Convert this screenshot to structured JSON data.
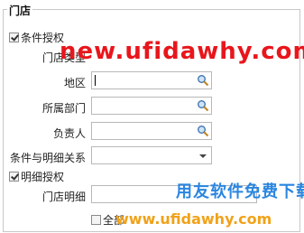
{
  "group_title": "门店",
  "condition_auth": {
    "label": "条件授权",
    "checked": true
  },
  "fields": [
    {
      "label": "门店类型",
      "value": ""
    },
    {
      "label": "地区",
      "value": ""
    },
    {
      "label": "所属部门",
      "value": ""
    },
    {
      "label": "负责人",
      "value": ""
    }
  ],
  "relation": {
    "label": "条件与明细关系",
    "value": ""
  },
  "detail_auth": {
    "label": "明细授权",
    "checked": true
  },
  "store_detail": {
    "label": "门店明细",
    "value": ""
  },
  "select_all": {
    "label": "全部",
    "checked": false
  },
  "watermarks": {
    "top": "new.ufidawhy.com",
    "cn": "用友软件免费下载",
    "bottom": "www.ufidawhy.com"
  },
  "colors": {
    "top_watermark": "#e8161c",
    "cn_watermark": "#2a86e0",
    "bottom_watermark": "#f1a21a"
  }
}
